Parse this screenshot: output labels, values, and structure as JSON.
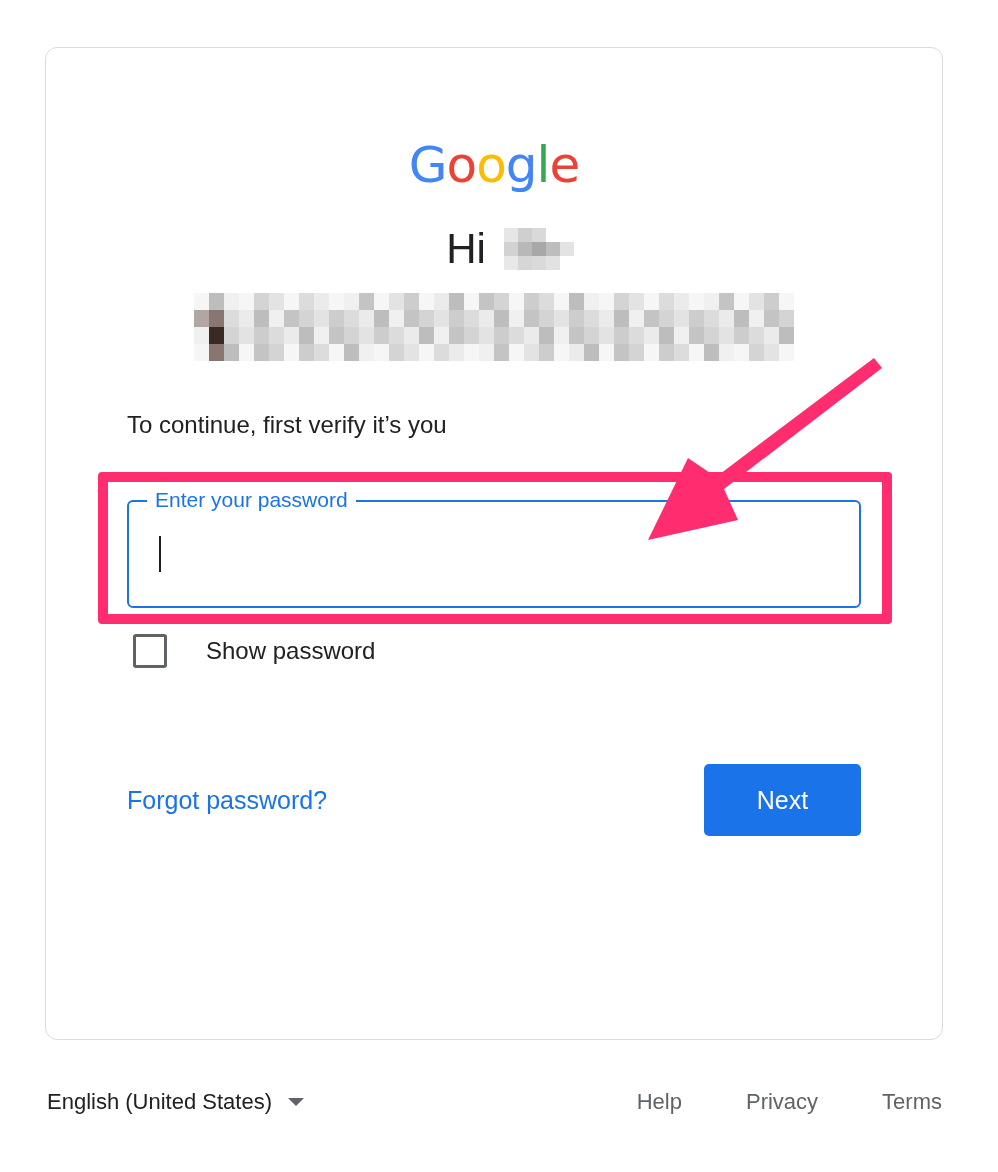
{
  "logo": "Google",
  "greeting": "Hi",
  "instruction": "To continue, first verify it’s you",
  "password_field": {
    "label": "Enter your password",
    "focused": true
  },
  "show_password": {
    "label": "Show password",
    "checked": false
  },
  "forgot_link": "Forgot password?",
  "next_button": "Next",
  "footer": {
    "language": "English (United States)",
    "links": [
      "Help",
      "Privacy",
      "Terms"
    ]
  }
}
